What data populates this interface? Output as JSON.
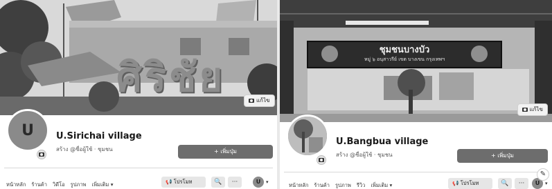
{
  "left": {
    "cover_text": "ศิริชัย",
    "edit_cover_label": "แก้ไข",
    "avatar_letter": "U",
    "page_name": "U.Sirichai village",
    "sub_line": "สร้าง @ชื่อผู้ใช้ · ชุมชน",
    "add_button_label": "+ เพิ่มปุ่ม",
    "tabs": [
      "หน้าหลัก",
      "ร้านค้า",
      "วิดีโอ",
      "รูปภาพ",
      "เพิ่มเติม ▾"
    ],
    "promote_label": "📢 โปรโมท",
    "search_glyph": "🔍",
    "more_glyph": "···",
    "mini_avatar_letter": "U",
    "caret": "▾"
  },
  "right": {
    "sign_title": "ชุมชนบางบัว",
    "sign_subtitle": "หมู่ ๖ อนุสาวรีย์ เขต บางเขน กรุงเทพฯ",
    "edit_cover_label": "แก้ไข",
    "page_name": "U.Bangbua village",
    "sub_line": "สร้าง @ชื่อผู้ใช้ · ชุมชน",
    "add_button_label": "+ เพิ่มปุ่ม",
    "tabs": [
      "หน้าหลัก",
      "ร้านค้า",
      "รูปภาพ",
      "รีวิว",
      "เพิ่มเติม ▾"
    ],
    "promote_label": "📢 โปรโมท",
    "search_glyph": "🔍",
    "more_glyph": "···",
    "mini_avatar_letter": "U",
    "caret": "▾",
    "compose_glyph": "✎"
  }
}
